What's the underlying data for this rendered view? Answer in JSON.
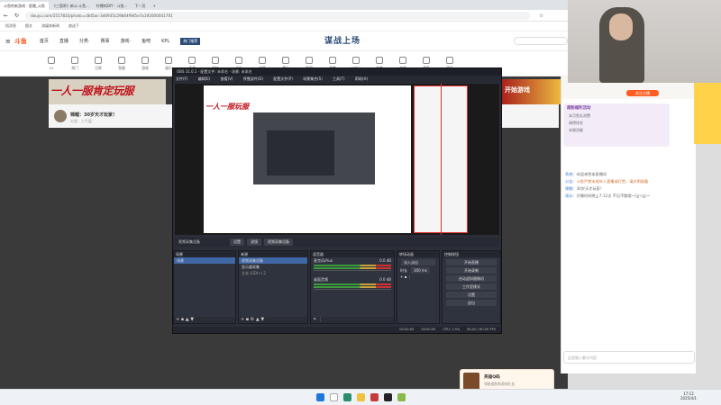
{
  "browser": {
    "tabs": [
      "斗鱼的新游戏 · 直播_斗鱼",
      "《三国杀》新斗·斗鱼...",
      "柠檬的DIY - 斗鱼...",
      "下一页",
      "+"
    ],
    "url": "douyu.com/2517833/photo=c8d5ac-3d0935c29b64f9d5e7a192000041701",
    "bookmarks": [
      "短消息",
      "图文",
      "流媒体新闻",
      "放送下"
    ]
  },
  "header": {
    "logo": "斗鱼",
    "nav": [
      "首页",
      "直播",
      "分类·",
      "赛事",
      "游戏·",
      "鱼吧",
      "KPL"
    ],
    "promo_center": "谋战上场",
    "hot_label": "热门推荐"
  },
  "categories": [
    {
      "label": "12",
      "icon": "calendar-icon"
    },
    {
      "label": "热门",
      "icon": "hot-icon"
    },
    {
      "label": "日常",
      "icon": "daily-icon"
    },
    {
      "label": "鱼塘",
      "icon": "pond-icon"
    },
    {
      "label": "游戏",
      "icon": "game-icon"
    },
    {
      "label": "娱乐",
      "icon": "ent-icon"
    },
    {
      "label": "手游",
      "icon": "mobile-icon"
    },
    {
      "label": "科技",
      "icon": "tech-icon"
    },
    {
      "label": "户外",
      "icon": "outdoor-icon"
    },
    {
      "label": "电竞",
      "icon": "esports-icon"
    },
    {
      "label": "音乐",
      "icon": "music-icon"
    },
    {
      "label": "影视",
      "icon": "film-icon"
    },
    {
      "label": "美食",
      "icon": "food-icon"
    },
    {
      "label": "二次元",
      "icon": "anime-icon"
    },
    {
      "label": "体育",
      "icon": "sport-icon"
    },
    {
      "label": "旅游",
      "icon": "travel-icon"
    },
    {
      "label": "赛事",
      "icon": "match-icon"
    },
    {
      "label": "更多",
      "icon": "more-icon"
    }
  ],
  "banner": {
    "title": "一人一服肯定玩服",
    "play_button": "开始游戏"
  },
  "streamer": {
    "title": "锦鲤：30岁天才玩家！",
    "meta": "分类 · 人气值"
  },
  "obs": {
    "title": "OBS 31.0.1 - 配置文件: 未命名 - 场景: 未命名",
    "menu": [
      "文件(F)",
      "编辑(E)",
      "查看(V)",
      "停靠部件(D)",
      "配置文件(P)",
      "场景集合(S)",
      "工具(T)",
      "帮助(H)"
    ],
    "preview_nested_banner": "一人一服玩服",
    "preview_label": "预览画面",
    "sourcebar": {
      "source": "视频采集设备",
      "settings": "设置",
      "filters": "滤镜",
      "device": "视频采集设备"
    },
    "docks": {
      "scenes": {
        "title": "场景",
        "items": [
          "场景"
        ]
      },
      "sources": {
        "title": "来源",
        "items": [
          "视频采集设备",
          "显示器采集",
          "文本 (GDI+) 2"
        ]
      },
      "mixer": {
        "title": "混音器",
        "channels": [
          {
            "name": "麦克风/Aux",
            "db": "0.0 dB"
          },
          {
            "name": "桌面音频",
            "db": "0.0 dB"
          }
        ]
      },
      "transitions": {
        "title": "转场动画",
        "type": "淡入淡出",
        "duration_label": "时长",
        "duration": "300 ms"
      },
      "controls": {
        "title": "控制按钮",
        "buttons": [
          "开始直播",
          "开始录制",
          "启动虚拟摄像机",
          "工作室模式",
          "设置",
          "退出"
        ]
      }
    },
    "status": {
      "live": "00:00:00",
      "rec": "00:00:00",
      "cpu": "CPU: 1.9%",
      "fps": "60.00 / 60.00 FPS"
    }
  },
  "chat": {
    "follow_label": "关注主播",
    "gift_card": {
      "title": "超粉福利活动",
      "rows": [
        "本月鱼丸消费",
        "周榜排名",
        "本周贡献"
      ]
    },
    "messages": [
      {
        "name": "系统",
        "text": "欢迎来到本直播间"
      },
      {
        "name": "公告",
        "text": "斗鱼严禁未成年人直播或打赏，请文明观看"
      },
      {
        "name": "锦鲤",
        "text": "30岁天才玩家！"
      },
      {
        "name": "观众",
        "text": "开播时间晚上7-12点 不见不散哦~(≧▽≦)~"
      }
    ],
    "input_placeholder": "这里输入聊天内容"
  },
  "giftbox": {
    "title": "英雄Q码",
    "subtitle": "领取皮肤和游戏礼包"
  },
  "taskbar": {
    "icons": [
      "windows-icon",
      "search-icon",
      "edge-icon",
      "folder-icon",
      "store-icon",
      "obs-icon",
      "chrome-icon"
    ],
    "time": "17:12",
    "date": "2025/4/1"
  }
}
